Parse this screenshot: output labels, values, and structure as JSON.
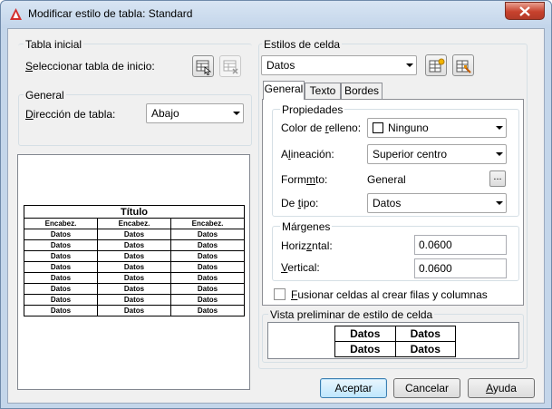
{
  "window": {
    "title": "Modificar estilo de tabla: Standard"
  },
  "tabla_inicial": {
    "group_label": "Tabla inicial",
    "select_label": "Seleccionar tabla de inicio:"
  },
  "general_group": {
    "group_label": "General",
    "direccion_label": "Dirección de tabla:",
    "direccion_value": "Abajo"
  },
  "preview": {
    "title": "Título",
    "header_row": [
      "Encabez.",
      "Encabez.",
      "Encabez."
    ],
    "rows": [
      [
        "Datos",
        "Datos",
        "Datos"
      ],
      [
        "Datos",
        "Datos",
        "Datos"
      ],
      [
        "Datos",
        "Datos",
        "Datos"
      ],
      [
        "Datos",
        "Datos",
        "Datos"
      ],
      [
        "Datos",
        "Datos",
        "Datos"
      ],
      [
        "Datos",
        "Datos",
        "Datos"
      ],
      [
        "Datos",
        "Datos",
        "Datos"
      ],
      [
        "Datos",
        "Datos",
        "Datos"
      ]
    ]
  },
  "estilos_celda": {
    "group_label": "Estilos de celda",
    "value": "Datos"
  },
  "tabs": [
    "General",
    "Texto",
    "Bordes"
  ],
  "propiedades": {
    "group_label": "Propiedades",
    "color_label": "Color de relleno:",
    "color_value": "Ninguno",
    "alineacion_label": "Alineación:",
    "alineacion_value": "Superior centro",
    "formato_label": "Formato:",
    "formato_value": "General",
    "formato_button": "...",
    "tipo_label": "De tipo:",
    "tipo_value": "Datos"
  },
  "margenes": {
    "group_label": "Márgenes",
    "horizontal_label": "Horizontal:",
    "horizontal_value": "0.0600",
    "vertical_label": "Vertical:",
    "vertical_value": "0.0600"
  },
  "fusionar_label": "Fusionar celdas al crear filas y columnas",
  "vista_preliminar": {
    "group_label": "Vista preliminar de estilo de celda",
    "cells": [
      [
        "Datos",
        "Datos"
      ],
      [
        "Datos",
        "Datos"
      ]
    ]
  },
  "buttons": {
    "aceptar": "Aceptar",
    "cancelar": "Cancelar",
    "ayuda": "Ayuda"
  }
}
